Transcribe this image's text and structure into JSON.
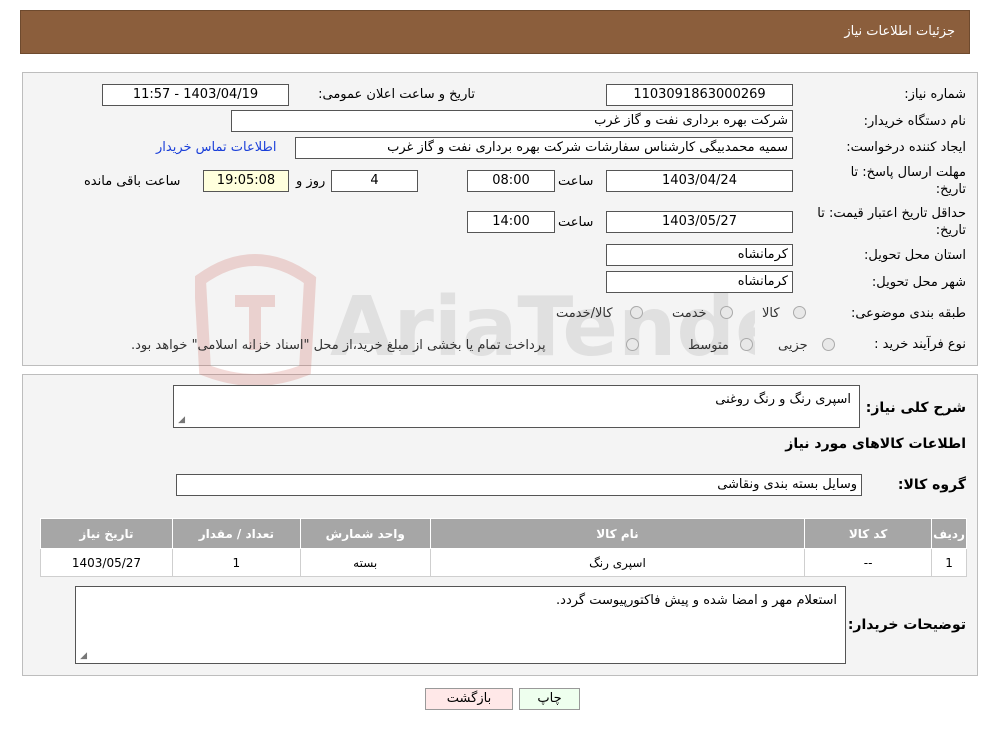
{
  "header": {
    "title": "جزئیات اطلاعات نیاز"
  },
  "fields": {
    "need_number_label": "شماره نیاز:",
    "need_number": "1103091863000269",
    "announce_label": "تاریخ و ساعت اعلان عمومی:",
    "announce_value": "1403/04/19 - 11:57",
    "buyer_org_label": "نام دستگاه خریدار:",
    "buyer_org": "شرکت بهره برداری نفت و گاز غرب",
    "creator_label": "ایجاد کننده درخواست:",
    "creator": "سمیه محمدبیگی کارشناس سفارشات شرکت بهره برداری نفت و گاز غرب",
    "contact_link": "اطلاعات تماس خریدار",
    "deadline_label_1": "مهلت ارسال پاسخ: تا",
    "deadline_label_2": "تاریخ:",
    "deadline_date": "1403/04/24",
    "time_label": "ساعت",
    "deadline_time": "08:00",
    "days": "4",
    "days_label": "روز و",
    "remaining_time": "19:05:08",
    "remaining_label": "ساعت باقی مانده",
    "price_label_1": "حداقل تاریخ اعتبار قیمت: تا",
    "price_label_2": "تاریخ:",
    "price_date": "1403/05/27",
    "price_time": "14:00",
    "province_label": "استان محل تحویل:",
    "province": "کرمانشاه",
    "city_label": "شهر محل تحویل:",
    "city": "کرمانشاه",
    "category_label": "طبقه بندی موضوعی:",
    "cat_options": [
      "کالا",
      "خدمت",
      "کالا/خدمت"
    ],
    "process_label": "نوع فرآیند خرید :",
    "process_options": [
      "جزیی",
      "متوسط"
    ],
    "payment_note": "پرداخت تمام یا بخشی از مبلغ خرید،از محل \"اسناد خزانه اسلامی\" خواهد بود."
  },
  "details": {
    "summary_label": "شرح کلی نیاز:",
    "summary": "اسپری رنگ و رنگ روغنی",
    "goods_info_title": "اطلاعات کالاهای مورد نیاز",
    "group_label": "گروه کالا:",
    "group": "وسایل بسته بندی  ونقاشی",
    "buyer_notes_label": "توضیحات خریدار:",
    "buyer_notes": "استعلام مهر و امضا شده و پیش فاکتورپیوست گردد."
  },
  "table": {
    "headers": [
      "ردیف",
      "کد کالا",
      "نام کالا",
      "واحد شمارش",
      "تعداد / مقدار",
      "تاریخ نیاز"
    ],
    "rows": [
      [
        "1",
        "--",
        "اسپری رنگ",
        "بسته",
        "1",
        "1403/05/27"
      ]
    ]
  },
  "buttons": {
    "print": "چاپ",
    "back": "بازگشت"
  },
  "watermark": {
    "text": "AriaTender.neT"
  },
  "colors": {
    "header": "#8b5e3c",
    "table_header": "#a6a6a6",
    "link": "#1a3fd9",
    "time_box": "#ffffdd",
    "back_button": "#ffe8e8",
    "print_button": "#eeffee"
  }
}
